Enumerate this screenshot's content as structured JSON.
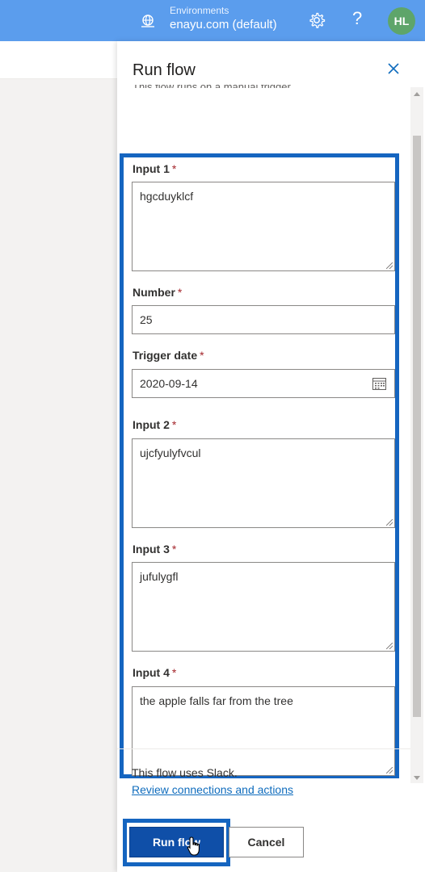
{
  "topbar": {
    "environment_label": "Environments",
    "environment_value": "enayu.com (default)",
    "help_glyph": "?",
    "avatar_initials": "HL",
    "accent_color": "#5b9ded"
  },
  "panel": {
    "title": "Run flow",
    "clipped_text": "This flow runs on a manual trigger"
  },
  "fields": [
    {
      "label": "Input 1",
      "required_mark": "*",
      "value": "hgcduyklcf"
    },
    {
      "label": "Number",
      "required_mark": "*",
      "value": "25"
    },
    {
      "label": "Trigger date",
      "required_mark": "*",
      "value": "2020-09-14"
    },
    {
      "label": "Input 2",
      "required_mark": "*",
      "value": "ujcfyulyfvcul"
    },
    {
      "label": "Input 3",
      "required_mark": "*",
      "value": "jufulygfl"
    },
    {
      "label": "Input 4",
      "required_mark": "*",
      "value": "the apple falls far from the tree"
    }
  ],
  "footer": {
    "uses_text": "This flow uses Slack.",
    "review_link": "Review connections and actions",
    "run_label": "Run flow",
    "cancel_label": "Cancel"
  },
  "icons": [
    "environment-icon",
    "gear-icon",
    "help-icon",
    "close-icon",
    "calendar-icon",
    "cursor-icon"
  ],
  "colors": {
    "primary_button": "#0f4fa8",
    "highlight_frame": "#1565c0",
    "link": "#0f6cbd",
    "required": "#a4262c"
  }
}
